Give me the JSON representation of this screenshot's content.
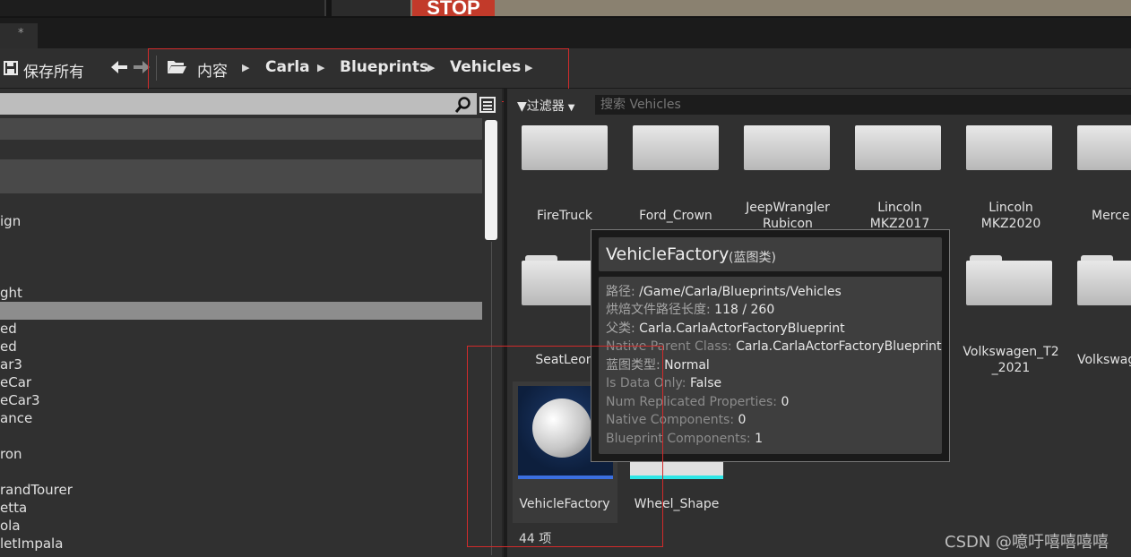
{
  "toolbar": {
    "save_all_label": "保存所有",
    "breadcrumbs": [
      "内容",
      "Carla",
      "Blueprints",
      "Vehicles"
    ]
  },
  "topbar": {
    "viewport_sign_text": "STOP"
  },
  "tab": {
    "modified_marker": "*"
  },
  "left_panel": {
    "items": [
      "ign",
      "ght",
      "ed",
      "ed",
      "ar3",
      "eCar",
      "eCar3",
      "ance",
      "ron",
      "randTourer",
      "etta",
      "ola",
      "letImpala"
    ]
  },
  "filter": {
    "label": "过滤器",
    "search_placeholder": "搜索 Vehicles"
  },
  "assets_row1": [
    "FireTruck",
    "Ford_Crown",
    "JeepWrangler Rubicon",
    "Lincoln MKZ2017",
    "Lincoln MKZ2020",
    "Merce"
  ],
  "assets_row2": [
    "SeatLeon",
    "Volkswagen_T2_2021",
    "Volkswag"
  ],
  "assets_row3": [
    "VehicleFactory",
    "Wheel_Shape"
  ],
  "item_count": "44 项",
  "tooltip": {
    "title": "VehicleFactory",
    "type": "(蓝图类)",
    "lines": [
      {
        "key": "路径:",
        "value": "/Game/Carla/Blueprints/Vehicles"
      },
      {
        "key": "烘焙文件路径长度:",
        "value": "118 / 260"
      },
      {
        "key": "父类:",
        "value": "Carla.CarlaActorFactoryBlueprint"
      },
      {
        "key": "Native Parent Class:",
        "value": "Carla.CarlaActorFactoryBlueprint"
      },
      {
        "key": "蓝图类型:",
        "value": "Normal"
      },
      {
        "key": "Is Data Only:",
        "value": "False"
      },
      {
        "key": "Num Replicated Properties:",
        "value": "0"
      },
      {
        "key": "Native Components:",
        "value": "0"
      },
      {
        "key": "Blueprint Components:",
        "value": "1"
      }
    ]
  },
  "watermark": "CSDN @噫吁嘻嘻嘻嘻",
  "colors": {
    "highlight_red": "#d12b2b",
    "selected_bar": "#3b6fe0",
    "wheel_bar": "#2ee6e6"
  }
}
